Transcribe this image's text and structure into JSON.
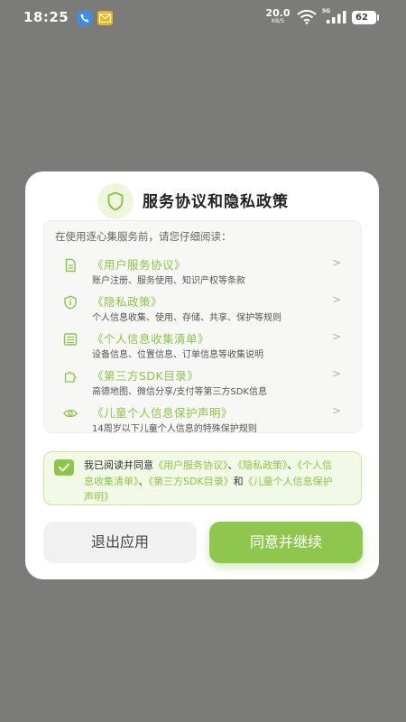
{
  "status_bar": {
    "time": "18:25",
    "net_speed_value": "20.0",
    "net_speed_unit": "KB/S",
    "signal_label": "5G",
    "battery": "62"
  },
  "dialog": {
    "title": "服务协议和隐私政策",
    "intro": "在使用逐心集服务前，请您仔细阅读：",
    "items": [
      {
        "title": "《用户服务协议》",
        "desc": "账户注册、服务使用、知识产权等条款",
        "icon": "document-icon"
      },
      {
        "title": "《隐私政策》",
        "desc": "个人信息收集、使用、存储、共享、保护等规则",
        "icon": "shield-info-icon"
      },
      {
        "title": "《个人信息收集清单》",
        "desc": "设备信息、位置信息、订单信息等收集说明",
        "icon": "list-icon"
      },
      {
        "title": "《第三方SDK目录》",
        "desc": "高德地图、微信分享/支付等第三方SDK信息",
        "icon": "puzzle-icon"
      },
      {
        "title": "《儿童个人信息保护声明》",
        "desc": "14周岁以下儿童个人信息的特殊保护规则",
        "icon": "eye-icon"
      }
    ],
    "consent": {
      "checked": true,
      "prefix": "我已阅读并同意",
      "link1": "《用户服务协议》",
      "sep1": "、",
      "link2": "《隐私政策》",
      "sep2": "、",
      "link3": "《个人信息收集清单》",
      "sep3": "、",
      "link4": "《第三方SDK目录》",
      "and": "和",
      "link5": "《儿童个人信息保护声明》"
    },
    "exit_label": "退出应用",
    "agree_label": "同意并继续"
  },
  "colors": {
    "accent": "#8cc64a",
    "overlay": "#7b7b7a"
  }
}
